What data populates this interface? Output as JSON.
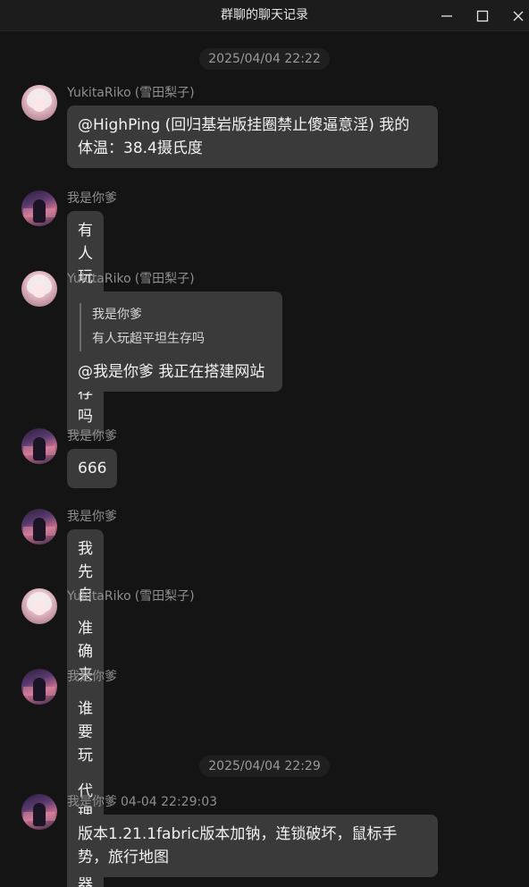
{
  "window": {
    "title": "群聊的聊天记录",
    "minimize_icon": "minimize-icon",
    "maximize_icon": "maximize-icon",
    "close_icon": "close-icon"
  },
  "timestamps": [
    "2025/04/04 22:22",
    "2025/04/04 22:29"
  ],
  "messages": [
    {
      "sender": "YukitaRiko",
      "nickname": "(雪田梨子)",
      "text_line1": "@HighPing (回归基岩版挂圈禁止傻逼意淫) 我的",
      "text_line2": "体温：38.4摄氏度"
    },
    {
      "sender": "我是你爹",
      "text": "有人玩超平坦生存吗"
    },
    {
      "sender": "YukitaRiko",
      "nickname": "(雪田梨子)",
      "quote_sender": "我是你爹",
      "quote_text": "有人玩超平坦生存吗",
      "text": "@我是你爹 我正在搭建网站"
    },
    {
      "sender": "我是你爹",
      "text": "666"
    },
    {
      "sender": "我是你爹",
      "text": "我先自己玩了"
    },
    {
      "sender": "YukitaRiko",
      "nickname": "(雪田梨子)",
      "text": "准确来说是配置代理服务器"
    },
    {
      "sender": "我是你爹",
      "text": "谁要玩"
    },
    {
      "sender": "我是你爹",
      "time": "04-04 22:29:03",
      "text_line1": "版本1.21.1fabric版本加钠，连锁破坏，鼠标手",
      "text_line2": "势，旅行地图"
    }
  ]
}
